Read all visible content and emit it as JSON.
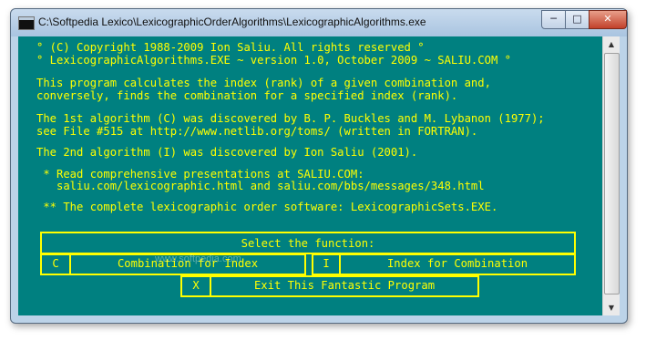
{
  "window": {
    "title": "C:\\Softpedia Lexico\\LexicographicOrderAlgorithms\\LexicographicAlgorithms.exe",
    "min_label": "─",
    "max_label": "□",
    "close_label": "✕"
  },
  "console": {
    "lines": [
      "° (C) Copyright 1988-2009 Ion Saliu. All rights reserved °",
      "° LexicographicAlgorithms.EXE ~ version 1.0, October 2009 ~ SALIU.COM °",
      "This program calculates the index (rank) of a given combination and,",
      "conversely, finds the combination for a specified index (rank).",
      "The 1st algorithm (C) was discovered by B. P. Buckles and M. Lybanon (1977);",
      "see File #515 at http://www.netlib.org/toms/ (written in FORTRAN).",
      "The 2nd algorithm (I) was discovered by Ion Saliu (2001).",
      " * Read comprehensive presentations at SALIU.COM:",
      "   saliu.com/lexicographic.html and saliu.com/bbs/messages/348.html",
      " ** The complete lexicographic order software: LexicographicSets.EXE."
    ],
    "menu": {
      "header": "Select the function:",
      "c_key": "C",
      "c_label": "Combination for Index",
      "i_key": "I",
      "i_label": "Index for Combination",
      "x_key": "X",
      "x_label": "Exit This Fantastic Program"
    }
  },
  "watermark": "www.softpedia.com",
  "colors": {
    "console_bg": "#008080",
    "console_fg": "#ffff00"
  }
}
